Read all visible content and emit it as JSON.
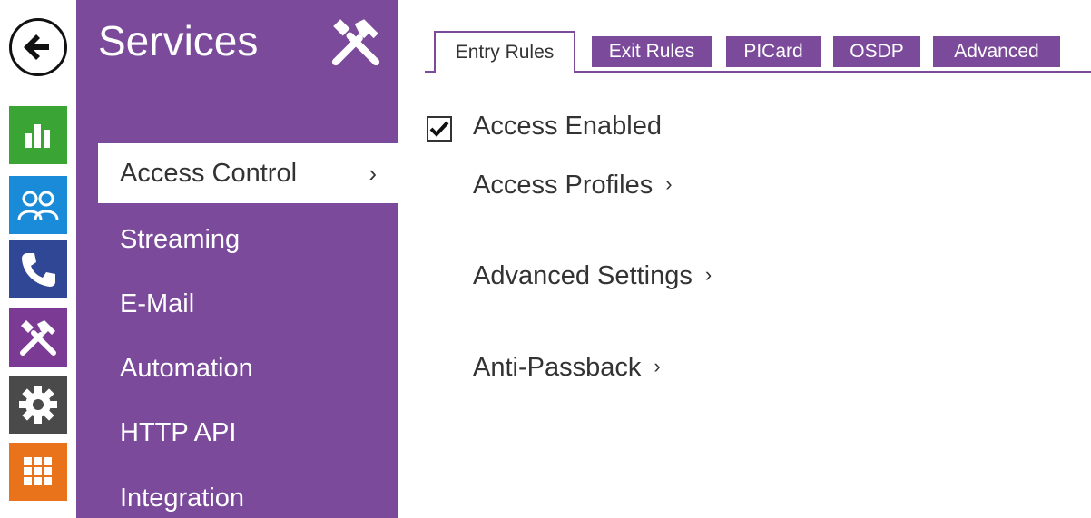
{
  "nav": {
    "back_icon": "arrow-left-icon",
    "rail": [
      {
        "id": "status",
        "icon": "bar-chart-icon",
        "color": "#3aa535"
      },
      {
        "id": "directory",
        "icon": "users-icon",
        "color": "#1a8bd8"
      },
      {
        "id": "calls",
        "icon": "phone-icon",
        "color": "#2f4795"
      },
      {
        "id": "services",
        "icon": "tools-icon",
        "color": "#7b3a94"
      },
      {
        "id": "hardware",
        "icon": "gear-icon",
        "color": "#4a4a4a"
      },
      {
        "id": "system",
        "icon": "grid-icon",
        "color": "#e8731a"
      }
    ]
  },
  "sidebar": {
    "title": "Services",
    "title_icon": "tools-icon",
    "accent": "#7b4a9b",
    "items": [
      {
        "label": "Access Control",
        "active": true
      },
      {
        "label": "Streaming"
      },
      {
        "label": "E-Mail"
      },
      {
        "label": "Automation"
      },
      {
        "label": "HTTP API"
      },
      {
        "label": "Integration"
      }
    ]
  },
  "tabs": [
    {
      "label": "Entry Rules",
      "active": true
    },
    {
      "label": "Exit Rules"
    },
    {
      "label": "PICard"
    },
    {
      "label": "OSDP"
    },
    {
      "label": "Advanced"
    }
  ],
  "content": {
    "access_enabled": {
      "label": "Access Enabled",
      "checked": true
    },
    "links": [
      {
        "label": "Access Profiles"
      },
      {
        "label": "Advanced Settings"
      },
      {
        "label": "Anti-Passback"
      }
    ]
  }
}
